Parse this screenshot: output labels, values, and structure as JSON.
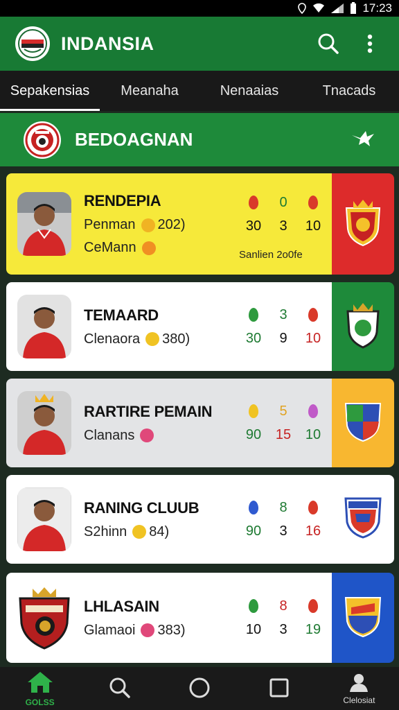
{
  "status_bar": {
    "time": "17:23"
  },
  "app": {
    "title": "INDANSIA"
  },
  "tabs": [
    {
      "label": "Sepakensias",
      "active": true
    },
    {
      "label": "Meanaha",
      "active": false
    },
    {
      "label": "Nenaaias",
      "active": false
    },
    {
      "label": "Tnacads",
      "active": false
    }
  ],
  "section": {
    "title": "BEDOAGNAN"
  },
  "cards": [
    {
      "name": "RENDEPIA",
      "line1": "Penman",
      "line1_value": "202)",
      "line2": "CeMann",
      "stats_top": [
        "",
        "0",
        ""
      ],
      "stats_bottom": [
        "30",
        "3",
        "10"
      ],
      "subtag": "Sanlien 2o0fe",
      "bg": "#f6e93a",
      "side_bg": "#dd2b2b"
    },
    {
      "name": "TEMAARD",
      "line1": "Clenaora",
      "line1_value": "380)",
      "stats_top": [
        "",
        "3",
        ""
      ],
      "stats_bottom": [
        "30",
        "9",
        "10"
      ],
      "bg": "#ffffff",
      "side_bg": "#1e8a3a"
    },
    {
      "name": "RARTIRE PEMAIN",
      "line1": "Clanans",
      "line1_value": "",
      "stats_top": [
        "",
        "5",
        ""
      ],
      "stats_bottom": [
        "90",
        "15",
        "10"
      ],
      "bg": "#e3e4e6",
      "side_bg": "#f8b730"
    },
    {
      "name": "RANING CLUUB",
      "line1": "S2hinn",
      "line1_value": "84)",
      "stats_top": [
        "",
        "8",
        ""
      ],
      "stats_bottom": [
        "90",
        "3",
        "16"
      ],
      "bg": "#ffffff",
      "side_bg": "#ffffff"
    },
    {
      "name": "LHLASAIN",
      "line1": "Glamaoi",
      "line1_value": "383)",
      "stats_top": [
        "",
        "8",
        ""
      ],
      "stats_bottom": [
        "10",
        "3",
        "19"
      ],
      "bg": "#ffffff",
      "side_bg": "#1f55c8"
    }
  ],
  "bottom_nav": {
    "home_label": "GOLSS",
    "profile_label": "Clelosiat"
  }
}
